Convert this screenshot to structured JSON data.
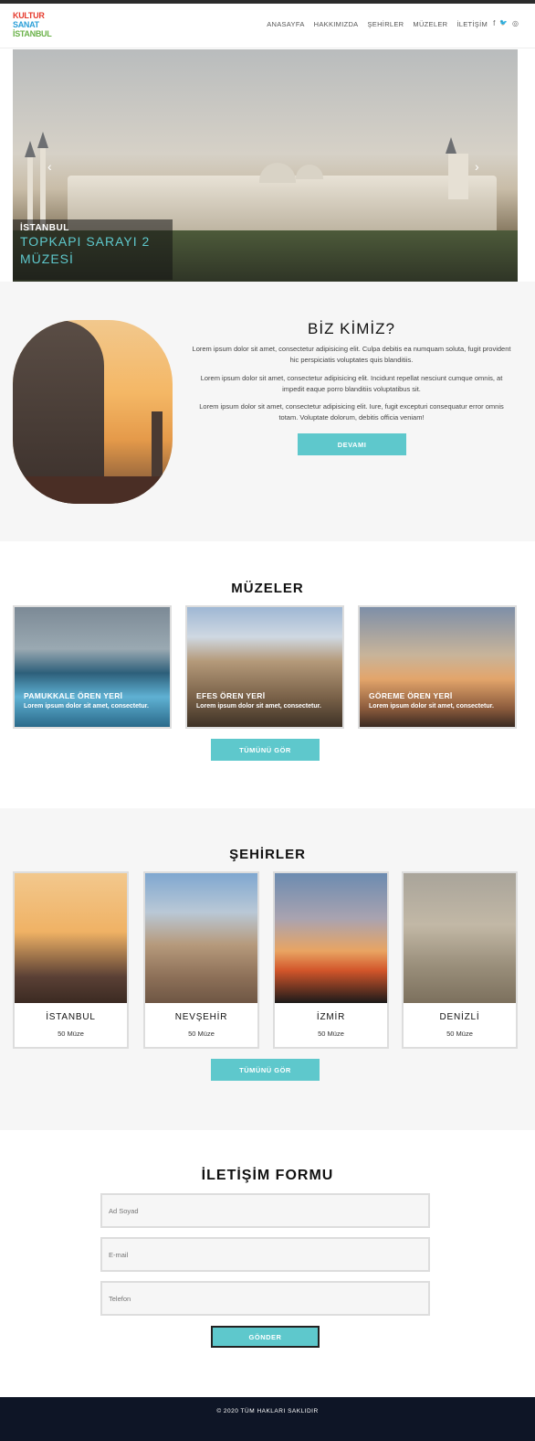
{
  "brand": {
    "logo_lines": [
      "KULTUR",
      "SANAT",
      "İSTANBUL"
    ],
    "logo_colors": [
      "#e63b2e",
      "#f2a81d",
      "#2b9fd8",
      "#6bb24a",
      "#9b4ea0"
    ]
  },
  "nav": {
    "items": [
      "ANASAYFA",
      "HAKKIMIZDA",
      "ŞEHİRLER",
      "MÜZELER",
      "İLETİŞİM"
    ],
    "social_icons": [
      "facebook-icon",
      "twitter-icon",
      "instagram-icon"
    ],
    "social_glyphs": [
      "f",
      "🐦",
      "◎"
    ]
  },
  "hero": {
    "city": "İSTANBUL",
    "title_line1": "TOPKAPI SARAYI 2",
    "title_line2": "MÜZESİ",
    "prev": "‹",
    "next": "›"
  },
  "about": {
    "heading": "BİZ KİMİZ?",
    "paragraphs": [
      "Lorem ipsum dolor sit amet, consectetur adipisicing elit. Culpa debitis ea numquam soluta, fugit provident hic perspiciatis voluptates quis blanditiis.",
      "Lorem ipsum dolor sit amet, consectetur adipisicing elit. Incidunt repellat nesciunt cumque omnis, at impedit eaque porro blanditiis voluptatibus sit.",
      "Lorem ipsum dolor sit amet, consectetur adipisicing elit. Iure, fugit excepturi consequatur error omnis totam. Voluptate dolorum, debitis officia veniam!"
    ],
    "button": "DEVAMI"
  },
  "museums": {
    "heading": "MÜZELER",
    "cards": [
      {
        "title": "PAMUKKALE ÖREN YERİ",
        "desc": "Lorem ipsum dolor sit amet, consectetur."
      },
      {
        "title": "EFES ÖREN YERİ",
        "desc": "Lorem ipsum dolor sit amet, consectetur."
      },
      {
        "title": "GÖREME ÖREN YERİ",
        "desc": "Lorem ipsum dolor sit amet, consectetur."
      }
    ],
    "button": "TÜMÜNÜ GÖR"
  },
  "cities": {
    "heading": "ŞEHİRLER",
    "cards": [
      {
        "name": "İSTANBUL",
        "count": "50 Müze"
      },
      {
        "name": "NEVŞEHİR",
        "count": "50 Müze"
      },
      {
        "name": "İZMİR",
        "count": "50 Müze"
      },
      {
        "name": "DENİZLİ",
        "count": "50 Müze"
      }
    ],
    "button": "TÜMÜNÜ GÖR"
  },
  "contact": {
    "heading": "İLETİŞİM FORMU",
    "name_placeholder": "Ad Soyad",
    "email_placeholder": "E-mail",
    "phone_placeholder": "Telefon",
    "submit": "GÖNDER"
  },
  "footer": {
    "text": "© 2020 TÜM HAKLARI SAKLIDIR"
  },
  "colors": {
    "accent": "#5ec8cc",
    "footer_bg": "#0e1526",
    "section_bg": "#f6f6f6"
  }
}
